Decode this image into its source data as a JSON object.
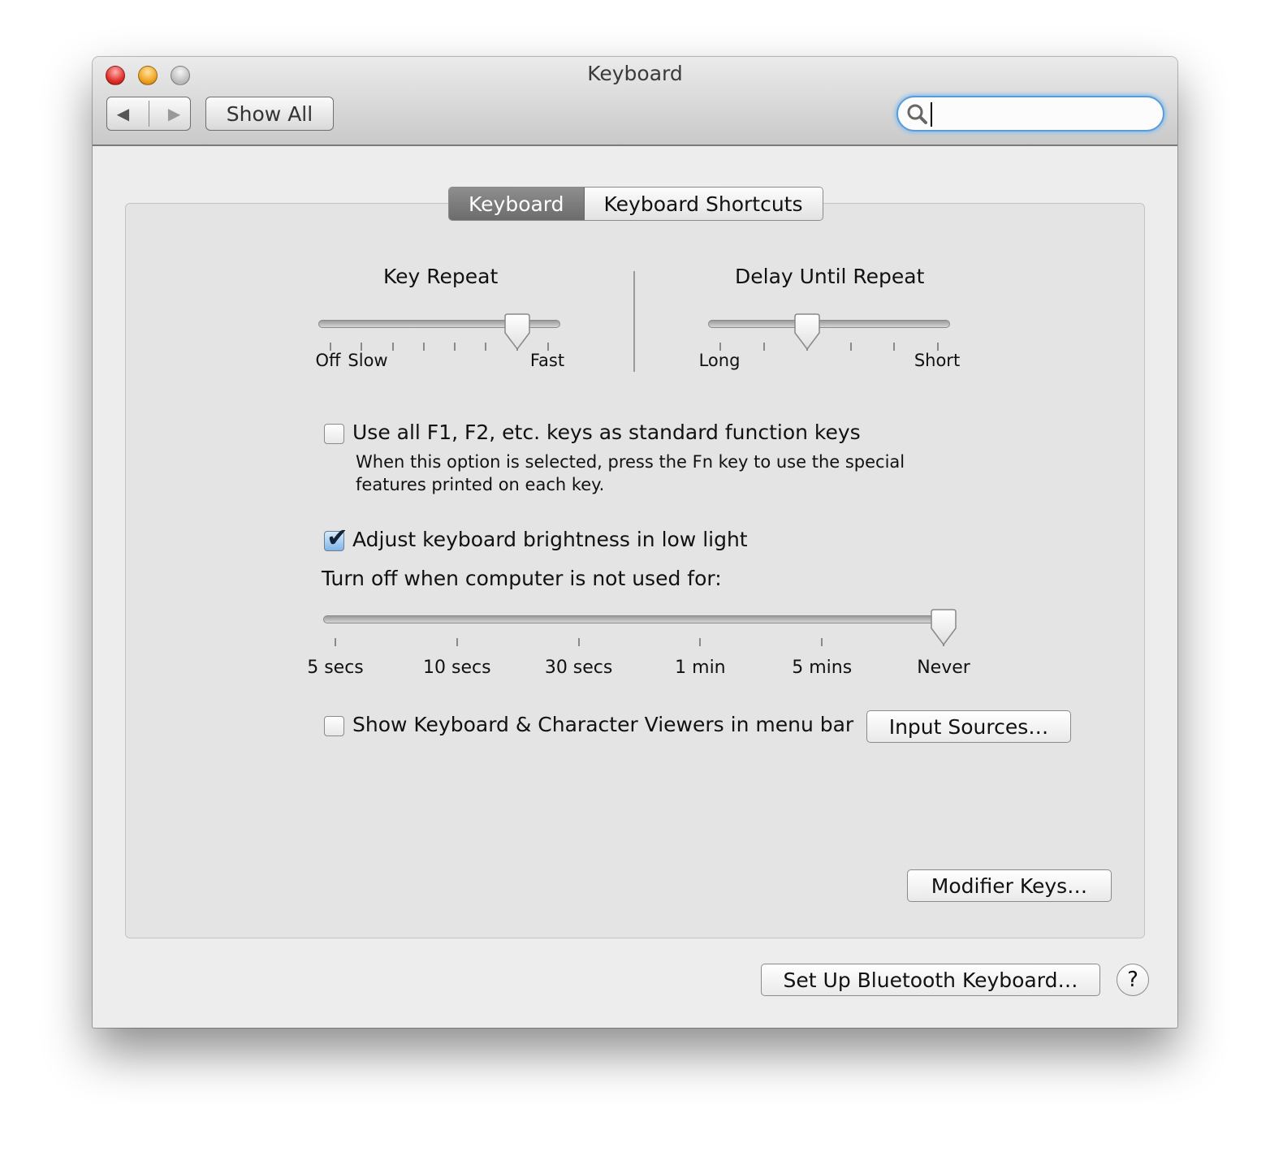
{
  "window": {
    "title": "Keyboard"
  },
  "toolbar": {
    "show_all": "Show All",
    "search_placeholder": ""
  },
  "tabs": [
    {
      "label": "Keyboard",
      "selected": true
    },
    {
      "label": "Keyboard Shortcuts",
      "selected": false
    }
  ],
  "key_repeat": {
    "title": "Key Repeat",
    "labels": [
      "Off",
      "Slow",
      "Fast"
    ],
    "tick_count": 8,
    "value_index": 6
  },
  "delay_until_repeat": {
    "title": "Delay Until Repeat",
    "labels": [
      "Long",
      "Short"
    ],
    "tick_count": 6,
    "value_index": 2
  },
  "fn_keys": {
    "label": "Use all F1, F2, etc. keys as standard function keys",
    "checked": false,
    "description_line1": "When this option is selected, press the Fn key to use the special",
    "description_line2": "features printed on each key."
  },
  "brightness": {
    "label": "Adjust keyboard brightness in low light",
    "checked": true
  },
  "turn_off": {
    "label": "Turn off when computer is not used for:",
    "ticks": [
      "5 secs",
      "10 secs",
      "30 secs",
      "1 min",
      "5 mins",
      "Never"
    ],
    "value_index": 5
  },
  "viewers": {
    "label": "Show Keyboard & Character Viewers in menu bar",
    "checked": false
  },
  "buttons": {
    "input_sources": "Input Sources…",
    "modifier_keys": "Modifier Keys…",
    "bluetooth": "Set Up Bluetooth Keyboard…",
    "help": "?"
  }
}
